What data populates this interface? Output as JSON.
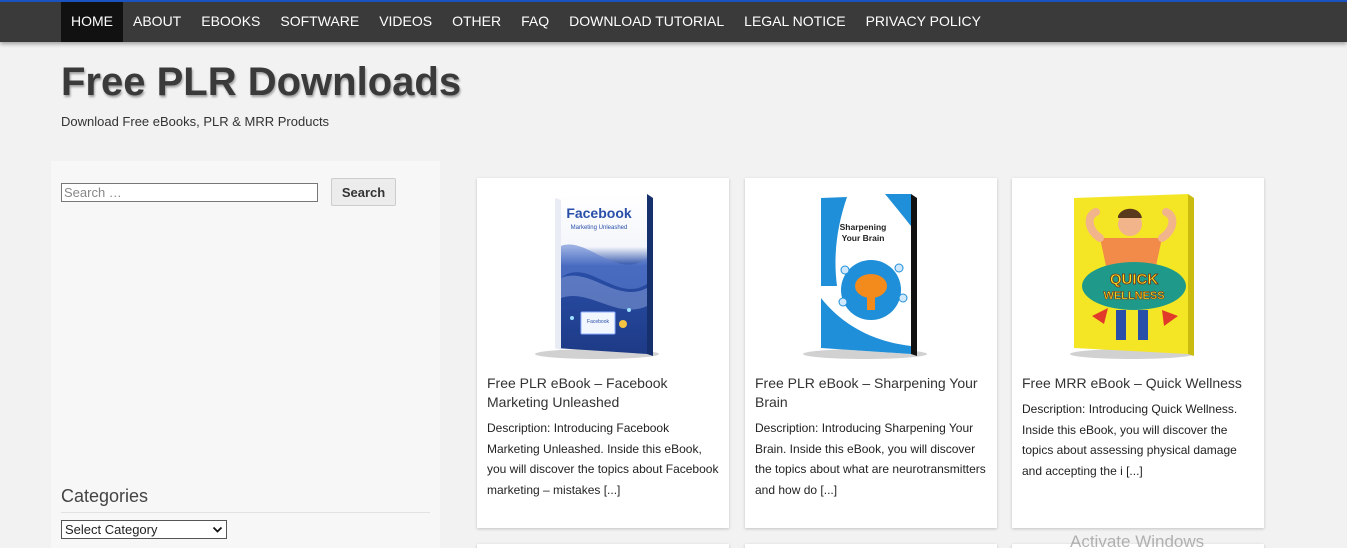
{
  "nav": {
    "items": [
      {
        "label": "HOME",
        "active": true
      },
      {
        "label": "ABOUT"
      },
      {
        "label": "EBOOKS"
      },
      {
        "label": "SOFTWARE"
      },
      {
        "label": "VIDEOS"
      },
      {
        "label": "OTHER"
      },
      {
        "label": "FAQ"
      },
      {
        "label": "DOWNLOAD TUTORIAL"
      },
      {
        "label": "LEGAL NOTICE"
      },
      {
        "label": "PRIVACY POLICY"
      }
    ]
  },
  "header": {
    "title": "Free PLR Downloads",
    "tagline": "Download Free eBooks, PLR & MRR Products"
  },
  "sidebar": {
    "search_placeholder": "Search …",
    "search_button": "Search",
    "categories_title": "Categories",
    "category_select": "Select Category"
  },
  "posts": [
    {
      "title": "Free PLR eBook – Facebook Marketing Unleashed",
      "description": "Description: Introducing Facebook Marketing Unleashed. Inside this eBook, you will discover the topics about Facebook marketing – mistakes",
      "more": "[...]",
      "cover_title": "Facebook",
      "cover_subtitle": "Marketing Unleashed",
      "cover_screen_label": "Facebook",
      "cover_color": "#2a4fa8"
    },
    {
      "title": "Free PLR eBook – Sharpening Your Brain",
      "description": "Description: Introducing Sharpening Your Brain. Inside this eBook, you will discover the topics about what are neurotransmitters and how do",
      "more": "[...]",
      "cover_title_line1": "Sharpening",
      "cover_title_line2": "Your Brain",
      "cover_color": "#1e8fd8"
    },
    {
      "title": "Free MRR eBook – Quick Wellness",
      "description": "Description: Introducing Quick Wellness. Inside this eBook, you will discover the topics about assessing physical damage and accepting the i",
      "more": "[...]",
      "cover_title_line1": "QUICK",
      "cover_title_line2": "WELLNESS",
      "cover_color": "#f5e625"
    }
  ],
  "watermark": "Activate Windows"
}
